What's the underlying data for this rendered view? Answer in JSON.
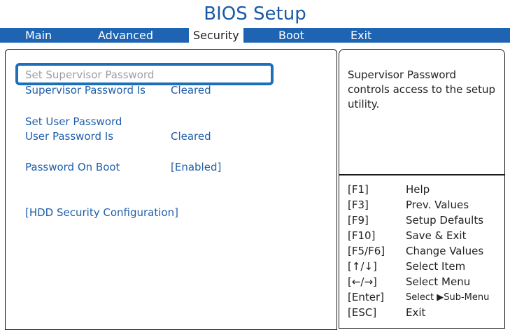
{
  "title": "BIOS Setup",
  "tabs": [
    {
      "label": "Main"
    },
    {
      "label": "Advanced"
    },
    {
      "label": "Security"
    },
    {
      "label": "Boot"
    },
    {
      "label": "Exit"
    }
  ],
  "security": {
    "set_supervisor_password": "Set Supervisor Password",
    "supervisor_password_is_label": "Supervisor Password Is",
    "supervisor_password_is_value": "Cleared",
    "set_user_password": "Set User Password",
    "user_password_is_label": "User Password Is",
    "user_password_is_value": "Cleared",
    "password_on_boot_label": "Password On Boot",
    "password_on_boot_value": "[Enabled]",
    "hdd_security_configuration": "[HDD Security Configuration]"
  },
  "help": {
    "text": "Supervisor Password controls access to the setup utility."
  },
  "keys": [
    {
      "key": "[F1]",
      "desc": "Help"
    },
    {
      "key": "[F3]",
      "desc": "Prev. Values"
    },
    {
      "key": "[F9]",
      "desc": "Setup Defaults"
    },
    {
      "key": "[F10]",
      "desc": "Save & Exit"
    },
    {
      "key": "[F5/F6]",
      "desc": "Change Values"
    },
    {
      "key": "[↑/↓]",
      "desc": "Select Item"
    },
    {
      "key": "[←/→]",
      "desc": "Select Menu"
    },
    {
      "key": "[Enter]",
      "desc": "Select ▶Sub-Menu"
    },
    {
      "key": "[ESC]",
      "desc": "Exit"
    }
  ],
  "colors": {
    "accent": "#1e64b3",
    "text_blue": "#1f5faa",
    "highlight_border": "#1c6fb8"
  }
}
